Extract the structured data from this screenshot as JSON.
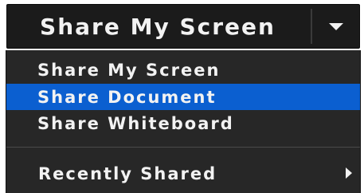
{
  "split_button": {
    "label": "Share My Screen",
    "dropdown_icon": "caret-down-icon"
  },
  "menu": {
    "items": [
      {
        "label": "Share My Screen",
        "selected": false
      },
      {
        "label": "Share Document",
        "selected": true
      },
      {
        "label": "Share Whiteboard",
        "selected": false
      }
    ],
    "recent": {
      "label": "Recently Shared",
      "submenu_icon": "chevron-right-icon"
    }
  },
  "colors": {
    "button_background": "#1b1b1b",
    "menu_background": "#272727",
    "selection": "#0b5fd0",
    "text": "#f2f2f2"
  }
}
